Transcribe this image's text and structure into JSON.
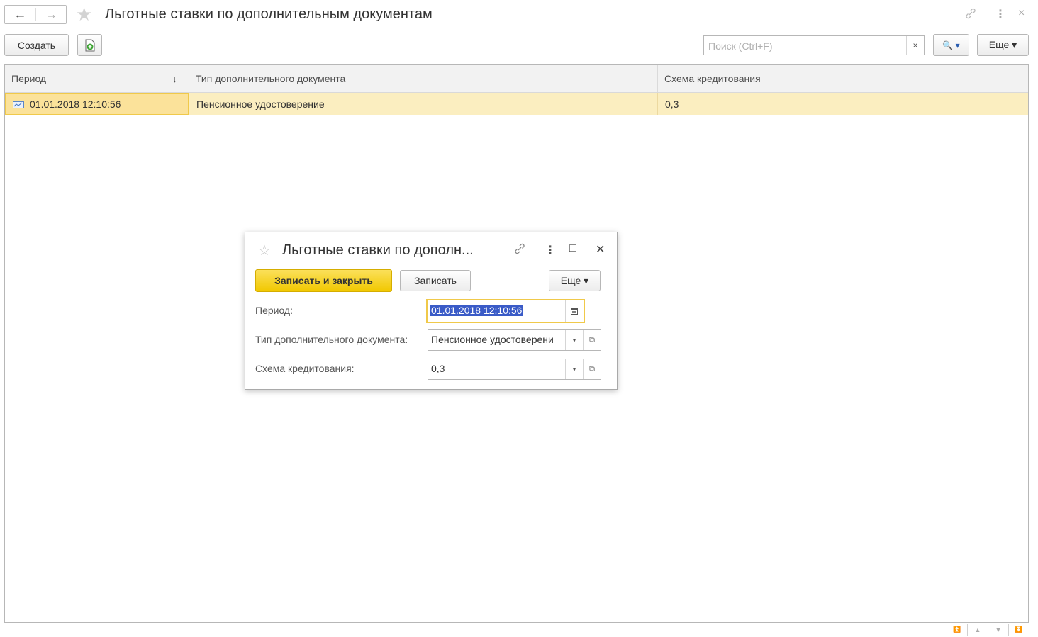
{
  "window": {
    "title": "Льготные ставки по дополнительным документам",
    "back_icon": "←",
    "forward_icon": "→",
    "favorite_icon": "★",
    "link_icon": "🔗",
    "more_icon": "⋮",
    "close_icon": "×"
  },
  "toolbar": {
    "create_label": "Создать",
    "copy_icon": "⊕",
    "search_placeholder": "Поиск (Ctrl+F)",
    "search_clear": "×",
    "search_button": "🔍 ▾",
    "more_label": "Еще ▾"
  },
  "table": {
    "columns": [
      {
        "label": "Период",
        "sort": "↓"
      },
      {
        "label": "Тип дополнительного документа"
      },
      {
        "label": "Схема кредитования"
      }
    ],
    "rows": [
      {
        "period": "01.01.2018 12:10:56",
        "doc_type": "Пенсионное удостоверение",
        "scheme": "0,3"
      }
    ]
  },
  "scroll_controls": [
    "⏫",
    "▲",
    "▼",
    "⏬"
  ],
  "dialog": {
    "title": "Льготные ставки по дополн...",
    "star_icon": "☆",
    "link_icon": "🔗",
    "more_icon": "⋮",
    "maximize_icon": "□",
    "close_icon": "✕",
    "save_close_label": "Записать и закрыть",
    "save_label": "Записать",
    "more_label": "Еще ▾",
    "fields": {
      "period_label": "Период:",
      "period_value": "01.01.2018 12:10:56",
      "doc_type_label": "Тип дополнительного документа:",
      "doc_type_value": "Пенсионное удостоверени",
      "scheme_label": "Схема кредитования:",
      "scheme_value": "0,3"
    }
  },
  "colors": {
    "accent_yellow": "#f6d32b",
    "row_highlight": "#fbeec0",
    "focus_border": "#f0c94a",
    "selection_blue": "#3a5bc7"
  }
}
